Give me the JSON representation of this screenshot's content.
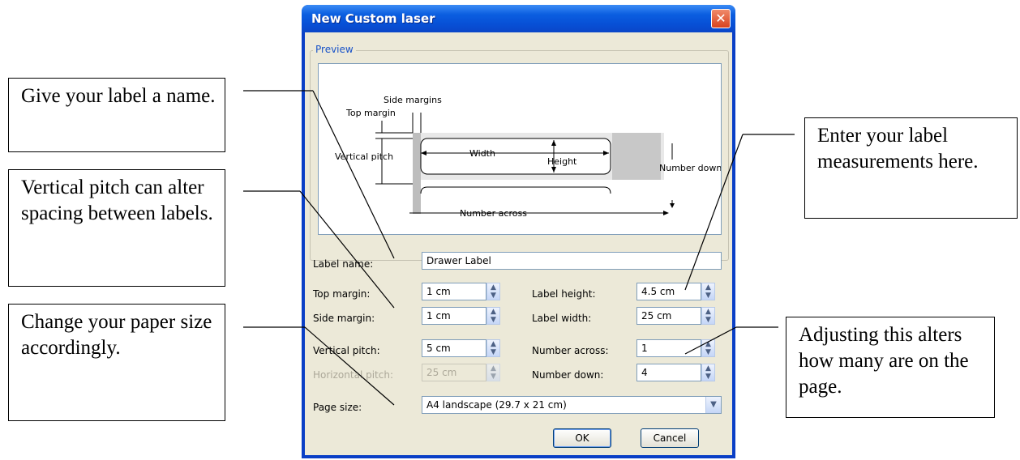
{
  "dialog": {
    "title": "New Custom laser",
    "close_icon": "close-icon",
    "preview_group_label": "Preview",
    "preview": {
      "side_margins": "Side margins",
      "top_margin": "Top margin",
      "vertical_pitch": "Vertical pitch",
      "width": "Width",
      "height": "Height",
      "number_down": "Number down",
      "number_across": "Number across"
    },
    "fields": {
      "label_name": {
        "label": "Label name:",
        "value": "Drawer Label"
      },
      "top_margin": {
        "label": "Top margin:",
        "value": "1 cm"
      },
      "side_margin": {
        "label": "Side margin:",
        "value": "1 cm"
      },
      "vertical_pitch": {
        "label": "Vertical pitch:",
        "value": "5 cm"
      },
      "horizontal_pitch": {
        "label": "Horizontal pitch:",
        "value": "25 cm"
      },
      "label_height": {
        "label": "Label height:",
        "value": "4.5 cm"
      },
      "label_width": {
        "label": "Label width:",
        "value": "25 cm"
      },
      "number_across": {
        "label": "Number across:",
        "value": "1"
      },
      "number_down": {
        "label": "Number down:",
        "value": "4"
      },
      "page_size": {
        "label": "Page size:",
        "value": "A4 landscape (29.7 x 21 cm)"
      }
    },
    "buttons": {
      "ok": "OK",
      "cancel": "Cancel"
    }
  },
  "callouts": {
    "label_name": "Give your label a name.",
    "vertical_pitch": "Vertical pitch can alter spacing between labels.",
    "paper_size": "Change your paper size accordingly.",
    "measurements": "Enter your label measurements here.",
    "number": "Adjusting this alters how many are on the page."
  }
}
